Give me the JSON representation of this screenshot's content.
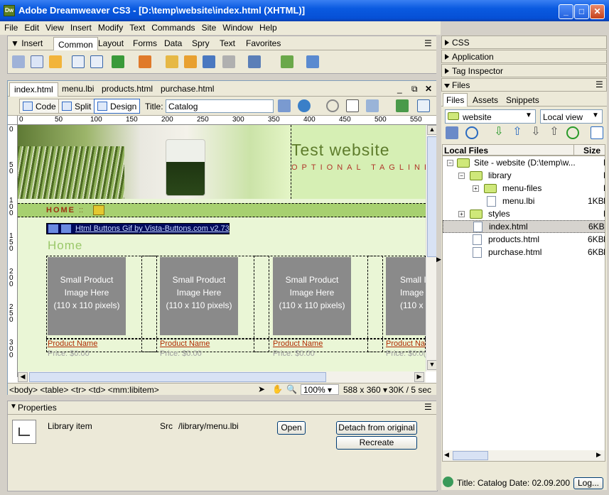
{
  "window": {
    "title": "Adobe Dreamweaver CS3 - [D:\\temp\\website\\index.html (XHTML)]",
    "app_icon_text": "Dw"
  },
  "menu": [
    "File",
    "Edit",
    "View",
    "Insert",
    "Modify",
    "Text",
    "Commands",
    "Site",
    "Window",
    "Help"
  ],
  "insert_panel": {
    "title": "Insert",
    "tabs": [
      "Common",
      "Layout",
      "Forms",
      "Data",
      "Spry",
      "Text",
      "Favorites"
    ],
    "active_tab": "Common"
  },
  "document": {
    "tabs": [
      "index.html",
      "menu.lbi",
      "products.html",
      "purchase.html"
    ],
    "active_tab": "index.html",
    "view_buttons": [
      "Code",
      "Split",
      "Design"
    ],
    "title_label": "Title:",
    "title_value": "Catalog",
    "ruler_ticks": [
      "0",
      "50",
      "100",
      "150",
      "200",
      "250",
      "300",
      "350",
      "400",
      "450",
      "500",
      "550"
    ],
    "vruler_ticks": [
      "0",
      "5 0",
      "1 0 0",
      "1 5 0",
      "2 0 0",
      "2 5 0",
      "3 0 0"
    ]
  },
  "page": {
    "site_title": "Test website",
    "tagline": "OPTIONAL TAGLINE",
    "nav_home": "HOME",
    "nav_sep": "::",
    "banner_link": "Html Buttons Gif by Vista-Buttons.com v2.73",
    "heading": "Home",
    "products": [
      {
        "image_text": [
          "Small Product",
          "Image Here",
          "(110 x 110 pixels)"
        ],
        "name": "Product Name",
        "price": "Price: $0.00"
      },
      {
        "image_text": [
          "Small Product",
          "Image Here",
          "(110 x 110 pixels)"
        ],
        "name": "Product Name",
        "price": "Price: $0.00"
      },
      {
        "image_text": [
          "Small Product",
          "Image Here",
          "(110 x 110 pixels)"
        ],
        "name": "Product Name",
        "price": "Price: $0.00"
      },
      {
        "image_text": [
          "Small I",
          "Image",
          "(110 x 11"
        ],
        "name": "Product Name",
        "price": "Price: $0.0("
      }
    ]
  },
  "status": {
    "tag_path": "<body> <table> <tr> <td> <mm:libitem>",
    "zoom": "100%",
    "size": "588 x 360",
    "download": "30K / 5 sec"
  },
  "properties": {
    "title": "Properties",
    "item_type": "Library item",
    "src_label": "Src",
    "src_value": "/library/menu.lbi",
    "open_button": "Open",
    "detach_button": "Detach from original",
    "recreate_button": "Recreate"
  },
  "right_panels": {
    "css": "CSS",
    "application": "Application",
    "tag_inspector": "Tag Inspector",
    "files": "Files",
    "files_tabs": [
      "Files",
      "Assets",
      "Snippets"
    ],
    "site_select": "website",
    "view_select": "Local view",
    "col_local": "Local Files",
    "col_size": "Size",
    "tree": [
      {
        "label": "Site - website (D:\\temp\\w...",
        "size": "",
        "type": "F",
        "kind": "root"
      },
      {
        "label": "library",
        "size": "",
        "type": "F",
        "kind": "folder"
      },
      {
        "label": "menu-files",
        "size": "",
        "type": "F",
        "kind": "folder"
      },
      {
        "label": "menu.lbi",
        "size": "1KB",
        "type": "L",
        "kind": "file"
      },
      {
        "label": "styles",
        "size": "",
        "type": "F",
        "kind": "folder"
      },
      {
        "label": "index.html",
        "size": "6KB",
        "type": "F",
        "kind": "file"
      },
      {
        "label": "products.html",
        "size": "6KB",
        "type": "F",
        "kind": "file"
      },
      {
        "label": "purchase.html",
        "size": "6KB",
        "type": "F",
        "kind": "file"
      }
    ],
    "footer_status": "Title: Catalog  Date: 02.09.200",
    "log_button": "Log..."
  }
}
